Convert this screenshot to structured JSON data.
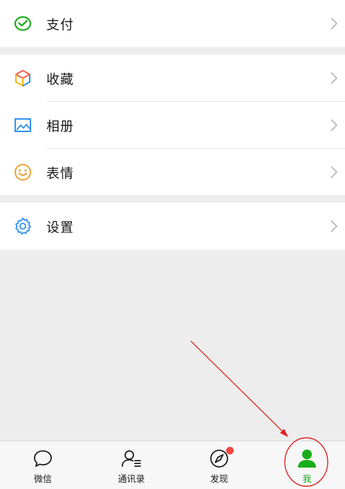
{
  "menu": {
    "pay": {
      "label": "支付",
      "icon": "wechat-pay-icon"
    },
    "favorites": {
      "label": "收藏",
      "icon": "cube-icon"
    },
    "album": {
      "label": "相册",
      "icon": "picture-icon"
    },
    "stickers": {
      "label": "表情",
      "icon": "smiley-icon"
    },
    "settings": {
      "label": "设置",
      "icon": "gear-icon"
    }
  },
  "tabbar": {
    "chats": {
      "label": "微信",
      "icon": "chat-bubble-icon"
    },
    "contacts": {
      "label": "通讯录",
      "icon": "contacts-icon"
    },
    "discover": {
      "label": "发现",
      "icon": "compass-icon",
      "badge": true
    },
    "me": {
      "label": "我",
      "icon": "person-icon",
      "active": true
    }
  },
  "colors": {
    "accent": "#1aad19",
    "badge": "#f3473f",
    "annotation": "#e02020"
  }
}
